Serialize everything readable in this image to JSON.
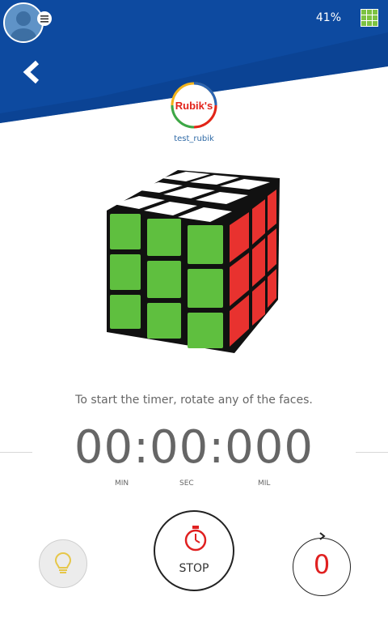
{
  "status_bar": {
    "battery": "41%"
  },
  "profile": {
    "username": "test_rubik"
  },
  "logo_text": "Rubik's",
  "instructions": "To start the timer, rotate any of the faces.",
  "timer": {
    "display": "00:00:000",
    "units": [
      "MIN",
      "SEC",
      "MIL"
    ]
  },
  "controls": {
    "stop_label": "STOP",
    "move_count": "0"
  },
  "colors": {
    "header_blue": "#0d4aa0",
    "cube_front": "#5fbf3f",
    "cube_top": "#ffffff",
    "cube_right": "#e8322f",
    "move_counter": "#e02020"
  },
  "icons": {
    "back": "chevron-left-icon",
    "grid": "grid-icon",
    "hint": "lightbulb-icon",
    "stopwatch": "stopwatch-icon",
    "undo": "undo-arrow-icon"
  }
}
